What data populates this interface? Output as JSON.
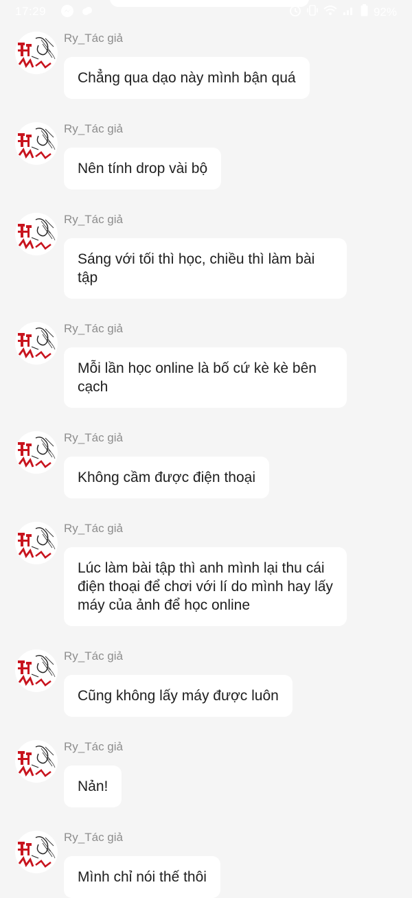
{
  "status_bar": {
    "time": "17:29",
    "battery": "92%",
    "icons": [
      "messenger-icon",
      "cloud-icon",
      "alarm-icon",
      "vibrate-icon",
      "wifi-icon",
      "signal-icon",
      "battery-icon"
    ]
  },
  "conversation": {
    "messages": [
      {
        "sender": "Ry_Tác giả",
        "text": "Chẳng qua dạo này mình bận quá"
      },
      {
        "sender": "Ry_Tác giả",
        "text": "Nên tính drop vài bộ"
      },
      {
        "sender": "Ry_Tác giả",
        "text": "Sáng với tối thì học, chiều thì làm bài tập"
      },
      {
        "sender": "Ry_Tác giả",
        "text": "Mỗi lần học online là bố cứ kè kè bên cạch"
      },
      {
        "sender": "Ry_Tác giả",
        "text": "Không cầm được điện thoại"
      },
      {
        "sender": "Ry_Tác giả",
        "text": "Lúc làm bài tập thì anh mình lại thu cái điện thoại để chơi với lí do mình hay lấy máy của ảnh để học online"
      },
      {
        "sender": "Ry_Tác giả",
        "text": "Cũng không lấy máy được luôn"
      },
      {
        "sender": "Ry_Tác giả",
        "text": "Nản!"
      },
      {
        "sender": "Ry_Tác giả",
        "text": "Mình chỉ nói thế thôi"
      }
    ]
  },
  "colors": {
    "background": "#f5f5f5",
    "bubble": "#ffffff",
    "sender_text": "#8d8d8d",
    "message_text": "#202020",
    "avatar_accent": "#c8141e"
  }
}
